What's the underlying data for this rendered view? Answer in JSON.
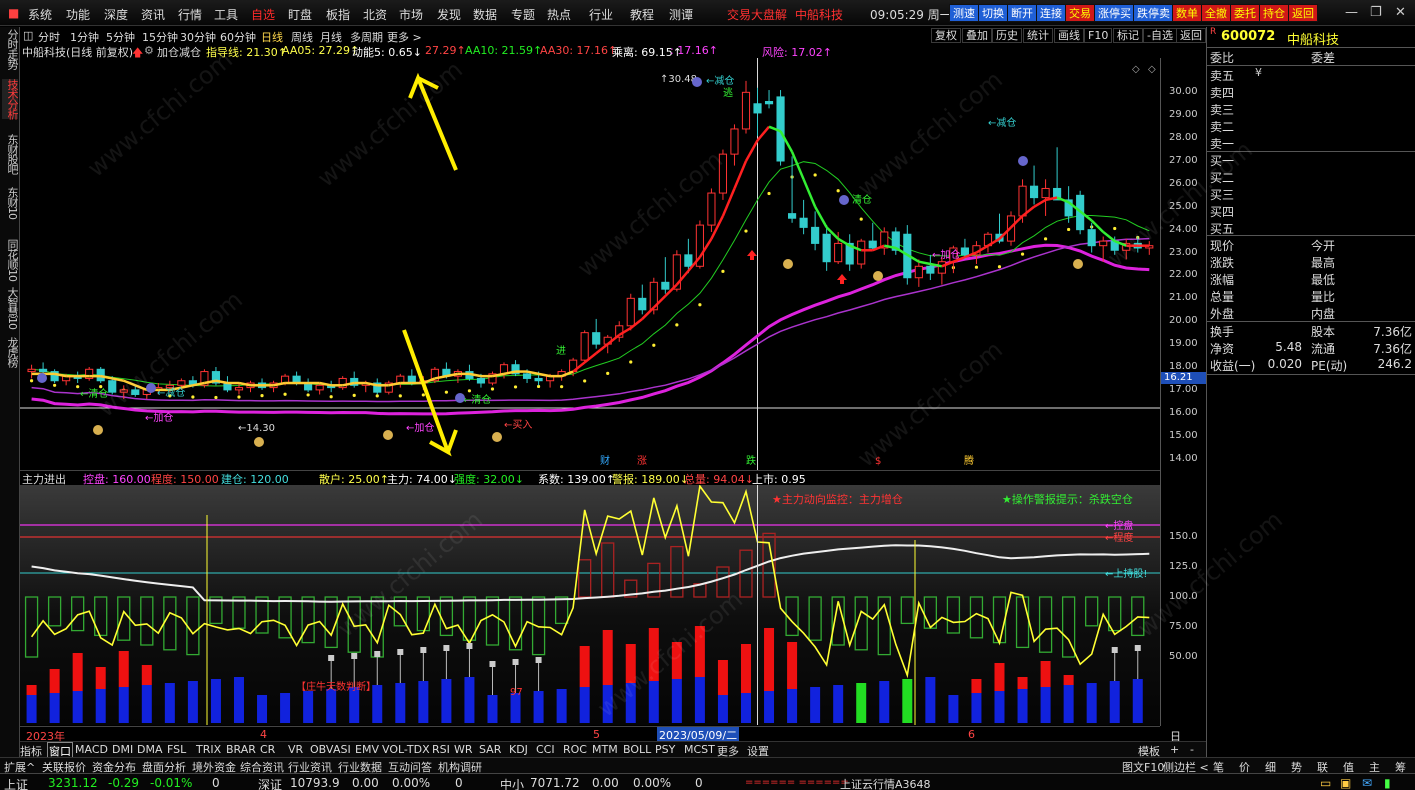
{
  "menu": {
    "items": [
      "系统",
      "功能",
      "深度",
      "资讯",
      "行情",
      "工具",
      "自选",
      "盯盘",
      "板指",
      "北资",
      "市场",
      "发现",
      "数据",
      "专题",
      "热点",
      "行业",
      "教程",
      "测谭"
    ],
    "ticker": [
      "交易大盘解",
      "中船科技"
    ],
    "clock": "09:05:29 周一",
    "quick_buttons": [
      "测速",
      "切换",
      "断开",
      "连接",
      "交易",
      "涨停买",
      "跌停卖",
      "数单",
      "全撤",
      "委托",
      "持仓",
      "返回"
    ]
  },
  "left_tabs": [
    "分时走势",
    "技术分析",
    "东财股吧",
    "东财10",
    "同花顺10",
    "大智慧10",
    "龙虎榜"
  ],
  "period_bar": {
    "items": [
      "分时",
      "1分钟",
      "5分钟",
      "15分钟",
      "30分钟",
      "60分钟",
      "日线",
      "周线",
      "月线",
      "多周期",
      "更多 >"
    ],
    "selected": "日线",
    "right_buttons": [
      "复权",
      "叠加",
      "历史",
      "统计",
      "画线",
      "F10",
      "标记",
      "-自选",
      "返回"
    ]
  },
  "info_line": [
    {
      "text": "中船科技(日线 前复权)",
      "color": "#dddddd"
    },
    {
      "text": "加仓减仓",
      "color": "#dddddd"
    },
    {
      "text": "指导线: 21.30↑",
      "color": "#ffff4c"
    },
    {
      "text": "AA05: 27.29↑",
      "color": "#ffff4c"
    },
    {
      "text": "动能5: 0.65↓",
      "color": "#ffffff"
    },
    {
      "text": "27.29↑",
      "color": "#ff4444"
    },
    {
      "text": "AA10: 21.59↑",
      "color": "#22ee22"
    },
    {
      "text": "AA30: 17.16↑",
      "color": "#ff4444"
    },
    {
      "text": "乘离: 69.15↑",
      "color": "#ffffff"
    },
    {
      "text": ": 17.16↑",
      "color": "#ff44ff"
    },
    {
      "text": "风险: 17.02↑",
      "color": "#ff44ff"
    }
  ],
  "main_chart": {
    "y_ticks": [
      "30.00",
      "29.00",
      "28.00",
      "27.00",
      "26.00",
      "25.00",
      "24.00",
      "23.00",
      "22.00",
      "21.00",
      "20.00",
      "19.00",
      "18.00",
      "17.00",
      "16.00",
      "15.00",
      "14.00"
    ],
    "cursor_value": "16.21",
    "high_label": "30.48",
    "low_label": "14.30",
    "annotations": {
      "qingcang": "清仓",
      "jiancang": "减仓",
      "jiacang": "加仓",
      "mairu": "买入",
      "tao": "逃",
      "jin": "进"
    },
    "event_marks": [
      "财",
      "涨",
      "跌",
      "$",
      "腾"
    ]
  },
  "indicator": {
    "header": [
      {
        "text": "主力进出",
        "color": "#dddddd"
      },
      {
        "text": "控盘: 160.00",
        "color": "#ff44ff"
      },
      {
        "text": "程度: 150.00",
        "color": "#ff4444"
      },
      {
        "text": "建仓: 120.00",
        "color": "#44dddd"
      },
      {
        "text": "散户: 25.00↑",
        "color": "#ffff4c"
      },
      {
        "text": "主力: 74.00↓",
        "color": "#ffffff"
      },
      {
        "text": "强度: 32.00↓",
        "color": "#22ee22"
      },
      {
        "text": "系数: 139.00↑",
        "color": "#ffffff"
      },
      {
        "text": "警报: 189.00↓",
        "color": "#ffff4c"
      },
      {
        "text": "总量: 94.04↓",
        "color": "#ff4444"
      },
      {
        "text": "上市: 0.95",
        "color": "#ffffff"
      }
    ],
    "alert_left": "★主力动向监控：主力增仓",
    "alert_right": "★操作警报提示：杀跌空仓",
    "line_labels": [
      "←控盘",
      "←程度",
      "←上持股!"
    ],
    "y_ticks": [
      "150.0",
      "125.0",
      "100.0",
      "75.00",
      "50.00"
    ],
    "note": "【庄牛天数判断】",
    "note_value": "97"
  },
  "date_bar": {
    "labels": [
      "2023年",
      "4",
      "5",
      "2023/05/09/二",
      "6"
    ],
    "right": "日线"
  },
  "tabs": {
    "items": [
      "指标",
      "窗口",
      "MACD",
      "DMI",
      "DMA",
      "FSL",
      "TRIX",
      "BRAR",
      "CR",
      "VR",
      "OBV",
      "ASI",
      "EMV",
      "VOL-TDX",
      "RSI",
      "WR",
      "SAR",
      "KDJ",
      "CCI",
      "ROC",
      "MTM",
      "BOLL",
      "PSY",
      "MCST",
      "更多",
      "设置"
    ],
    "selected": "窗口",
    "right": [
      "模板",
      "+",
      "-"
    ]
  },
  "tabs2": {
    "items": [
      "扩展^",
      "关联报价",
      "资金分布",
      "盘面分析",
      "境外资金",
      "综合资讯",
      "行业资讯",
      "行业数据",
      "互动问答",
      "机构调研"
    ],
    "right": "图文F10",
    "right2": "侧边栏 <",
    "far_right": [
      "笔",
      "价",
      "细",
      "势",
      "联",
      "值",
      "主",
      "筹"
    ]
  },
  "status": {
    "sh_name": "上证",
    "sh_value": "3231.12",
    "sh_change": "-0.29",
    "sh_pct": "-0.01%",
    "sh_vol": "0",
    "sz_name": "深证",
    "sz_value": "10793.9",
    "sz_change": "0.00",
    "sz_pct": "0.00%",
    "sz_vol": "0",
    "zx_name": "中小",
    "zx_value": "7071.72",
    "zx_change": "0.00",
    "zx_pct": "0.00%",
    "zx_vol": "0",
    "marquee": "====== ======",
    "cloud": "上证云行情A3648"
  },
  "right_panel": {
    "code": "600072",
    "name": "中船科技",
    "header_left": "委比",
    "header_right": "委差",
    "asks": [
      "卖五",
      "卖四",
      "卖三",
      "卖二",
      "卖一"
    ],
    "bids": [
      "买一",
      "买二",
      "买三",
      "买四",
      "买五"
    ],
    "rows": [
      {
        "l": "现价",
        "l_val": "",
        "r": "今开",
        "r_val": ""
      },
      {
        "l": "涨跌",
        "l_val": "",
        "r": "最高",
        "r_val": ""
      },
      {
        "l": "涨幅",
        "l_val": "",
        "r": "最低",
        "r_val": ""
      },
      {
        "l": "总量",
        "l_val": "",
        "r": "量比",
        "r_val": ""
      },
      {
        "l": "外盘",
        "l_val": "",
        "r": "内盘",
        "r_val": ""
      }
    ],
    "rows2": [
      {
        "l": "换手",
        "l_val": "",
        "r": "股本",
        "r_val": "7.36亿"
      },
      {
        "l": "净资",
        "l_val": "5.48",
        "r": "流通",
        "r_val": "7.36亿"
      },
      {
        "l": "收益(一)",
        "l_val": "0.020",
        "r": "PE(动)",
        "r_val": "246.2"
      }
    ]
  },
  "watermark": "www.cfchi.com",
  "colors": {
    "up": "#ff3333",
    "down": "#33cccc",
    "ma_fast": "#ff2020",
    "ma_mid": "#22dd22",
    "ma_slow": "#dd22dd",
    "yellow": "#ffff33",
    "accent_blue": "#1f5fd6"
  },
  "chart_data": {
    "type": "candlestick",
    "y_range": [
      13.5,
      31.5
    ],
    "candles": [
      [
        17.8,
        18.1,
        17.5,
        17.9
      ],
      [
        17.9,
        18.2,
        17.6,
        17.8
      ],
      [
        17.8,
        17.9,
        17.3,
        17.4
      ],
      [
        17.4,
        17.7,
        17.2,
        17.6
      ],
      [
        17.6,
        17.8,
        17.3,
        17.5
      ],
      [
        17.5,
        18.0,
        17.4,
        17.9
      ],
      [
        17.9,
        18.0,
        17.3,
        17.4
      ],
      [
        17.4,
        17.6,
        16.8,
        16.9
      ],
      [
        16.9,
        17.2,
        16.6,
        17.0
      ],
      [
        17.0,
        17.2,
        16.7,
        16.8
      ],
      [
        16.8,
        17.1,
        16.6,
        17.0
      ],
      [
        17.0,
        17.3,
        16.8,
        17.1
      ],
      [
        17.1,
        17.4,
        16.9,
        17.2
      ],
      [
        17.2,
        17.5,
        17.0,
        17.4
      ],
      [
        17.4,
        17.6,
        17.1,
        17.2
      ],
      [
        17.2,
        17.9,
        17.1,
        17.8
      ],
      [
        17.8,
        18.0,
        17.2,
        17.3
      ],
      [
        17.3,
        17.6,
        16.9,
        17.0
      ],
      [
        17.0,
        17.3,
        16.8,
        17.1
      ],
      [
        17.1,
        17.4,
        16.9,
        17.3
      ],
      [
        17.3,
        17.5,
        17.0,
        17.1
      ],
      [
        17.1,
        17.4,
        16.9,
        17.3
      ],
      [
        17.3,
        17.7,
        17.2,
        17.6
      ],
      [
        17.6,
        17.8,
        17.2,
        17.3
      ],
      [
        17.3,
        17.5,
        16.9,
        17.0
      ],
      [
        17.0,
        17.3,
        16.8,
        17.2
      ],
      [
        17.2,
        17.4,
        16.9,
        17.1
      ],
      [
        17.1,
        17.6,
        17.0,
        17.5
      ],
      [
        17.5,
        17.8,
        17.1,
        17.2
      ],
      [
        17.2,
        17.4,
        16.9,
        17.3
      ],
      [
        17.3,
        17.5,
        16.8,
        16.9
      ],
      [
        16.9,
        17.4,
        16.8,
        17.3
      ],
      [
        17.3,
        17.7,
        17.1,
        17.6
      ],
      [
        17.6,
        17.9,
        17.2,
        17.3
      ],
      [
        17.3,
        17.6,
        17.0,
        17.4
      ],
      [
        17.4,
        18.0,
        17.3,
        17.9
      ],
      [
        17.9,
        18.2,
        17.5,
        17.6
      ],
      [
        17.6,
        17.9,
        17.3,
        17.8
      ],
      [
        17.8,
        18.1,
        17.4,
        17.5
      ],
      [
        17.5,
        17.7,
        17.1,
        17.3
      ],
      [
        17.3,
        17.8,
        17.2,
        17.7
      ],
      [
        17.7,
        18.2,
        17.5,
        18.1
      ],
      [
        18.1,
        18.3,
        17.6,
        17.7
      ],
      [
        17.7,
        17.9,
        17.3,
        17.5
      ],
      [
        17.5,
        17.8,
        17.2,
        17.4
      ],
      [
        17.4,
        17.7,
        17.1,
        17.6
      ],
      [
        17.6,
        17.9,
        17.4,
        17.8
      ],
      [
        17.8,
        18.4,
        17.6,
        18.3
      ],
      [
        18.3,
        19.6,
        18.2,
        19.5
      ],
      [
        19.5,
        20.1,
        18.8,
        19.0
      ],
      [
        19.0,
        19.4,
        18.6,
        19.3
      ],
      [
        19.3,
        20.0,
        19.1,
        19.8
      ],
      [
        19.8,
        21.2,
        19.6,
        21.0
      ],
      [
        21.0,
        21.6,
        20.3,
        20.5
      ],
      [
        20.5,
        21.9,
        20.3,
        21.7
      ],
      [
        21.7,
        22.8,
        21.2,
        21.4
      ],
      [
        21.4,
        23.1,
        21.3,
        22.9
      ],
      [
        22.9,
        23.6,
        22.1,
        22.4
      ],
      [
        22.4,
        24.4,
        22.3,
        24.2
      ],
      [
        24.2,
        25.8,
        23.9,
        25.6
      ],
      [
        25.6,
        27.5,
        25.3,
        27.3
      ],
      [
        27.3,
        28.6,
        26.8,
        28.4
      ],
      [
        28.4,
        30.5,
        28.2,
        30.0
      ],
      [
        29.5,
        30.2,
        28.1,
        29.1
      ],
      [
        29.6,
        30.1,
        29.3,
        29.5
      ],
      [
        29.8,
        30.1,
        26.8,
        27.0
      ],
      [
        24.7,
        27.2,
        24.3,
        24.5
      ],
      [
        24.5,
        25.3,
        23.8,
        24.1
      ],
      [
        24.1,
        24.8,
        23.1,
        23.4
      ],
      [
        23.8,
        24.2,
        22.2,
        22.6
      ],
      [
        22.6,
        23.9,
        22.5,
        23.4
      ],
      [
        23.4,
        23.8,
        22.2,
        22.5
      ],
      [
        22.5,
        23.6,
        22.3,
        23.5
      ],
      [
        23.5,
        24.3,
        23.1,
        23.2
      ],
      [
        23.2,
        24.1,
        22.9,
        23.9
      ],
      [
        23.9,
        24.1,
        22.9,
        23.1
      ],
      [
        23.8,
        24.2,
        21.6,
        21.9
      ],
      [
        21.9,
        22.7,
        21.5,
        22.4
      ],
      [
        22.4,
        22.9,
        21.8,
        22.1
      ],
      [
        22.1,
        22.8,
        21.6,
        22.6
      ],
      [
        22.6,
        23.3,
        22.1,
        23.2
      ],
      [
        23.2,
        23.6,
        22.7,
        22.9
      ],
      [
        22.9,
        23.5,
        22.5,
        23.3
      ],
      [
        23.3,
        23.9,
        23.0,
        23.8
      ],
      [
        23.8,
        24.7,
        23.4,
        23.5
      ],
      [
        23.5,
        24.8,
        23.3,
        24.6
      ],
      [
        24.6,
        26.2,
        24.3,
        25.9
      ],
      [
        25.9,
        26.8,
        25.1,
        25.4
      ],
      [
        25.4,
        26.2,
        24.6,
        25.8
      ],
      [
        25.8,
        27.6,
        25.3,
        25.3
      ],
      [
        25.3,
        25.9,
        24.3,
        24.6
      ],
      [
        25.5,
        25.7,
        23.8,
        24.0
      ],
      [
        24.0,
        24.3,
        23.0,
        23.3
      ],
      [
        23.3,
        23.7,
        22.6,
        23.5
      ],
      [
        23.5,
        23.7,
        22.9,
        23.1
      ],
      [
        23.1,
        23.6,
        22.7,
        23.4
      ],
      [
        23.4,
        23.7,
        23.0,
        23.2
      ],
      [
        23.2,
        23.5,
        22.9,
        23.3
      ]
    ],
    "ma_fast": [
      17.7,
      17.7,
      17.7,
      17.6,
      17.6,
      17.6,
      17.6,
      17.5,
      17.4,
      17.2,
      17.0,
      17.0,
      17.0,
      17.1,
      17.2,
      17.3,
      17.4,
      17.3,
      17.3,
      17.2,
      17.2,
      17.2,
      17.3,
      17.3,
      17.3,
      17.3,
      17.2,
      17.2,
      17.3,
      17.3,
      17.2,
      17.2,
      17.3,
      17.3,
      17.3,
      17.5,
      17.6,
      17.7,
      17.7,
      17.6,
      17.6,
      17.7,
      17.8,
      17.8,
      17.7,
      17.6,
      17.6,
      17.8,
      18.2,
      18.6,
      19.0,
      19.4,
      19.7,
      20.1,
      20.6,
      21.1,
      21.6,
      22.2,
      22.8,
      23.6,
      24.6,
      25.8,
      27.0,
      27.9,
      28.5,
      28.3,
      27.4,
      26.2,
      25.0,
      24.1,
      23.6,
      23.3,
      23.1,
      23.1,
      23.3,
      23.2,
      22.9,
      22.6,
      22.5,
      22.4,
      22.6,
      22.8,
      23.0,
      23.3,
      23.6,
      24.1,
      24.6,
      25.0,
      25.3,
      25.4,
      25.2,
      24.8,
      24.4,
      23.9,
      23.5,
      23.3,
      23.3,
      23.3
    ]
  }
}
